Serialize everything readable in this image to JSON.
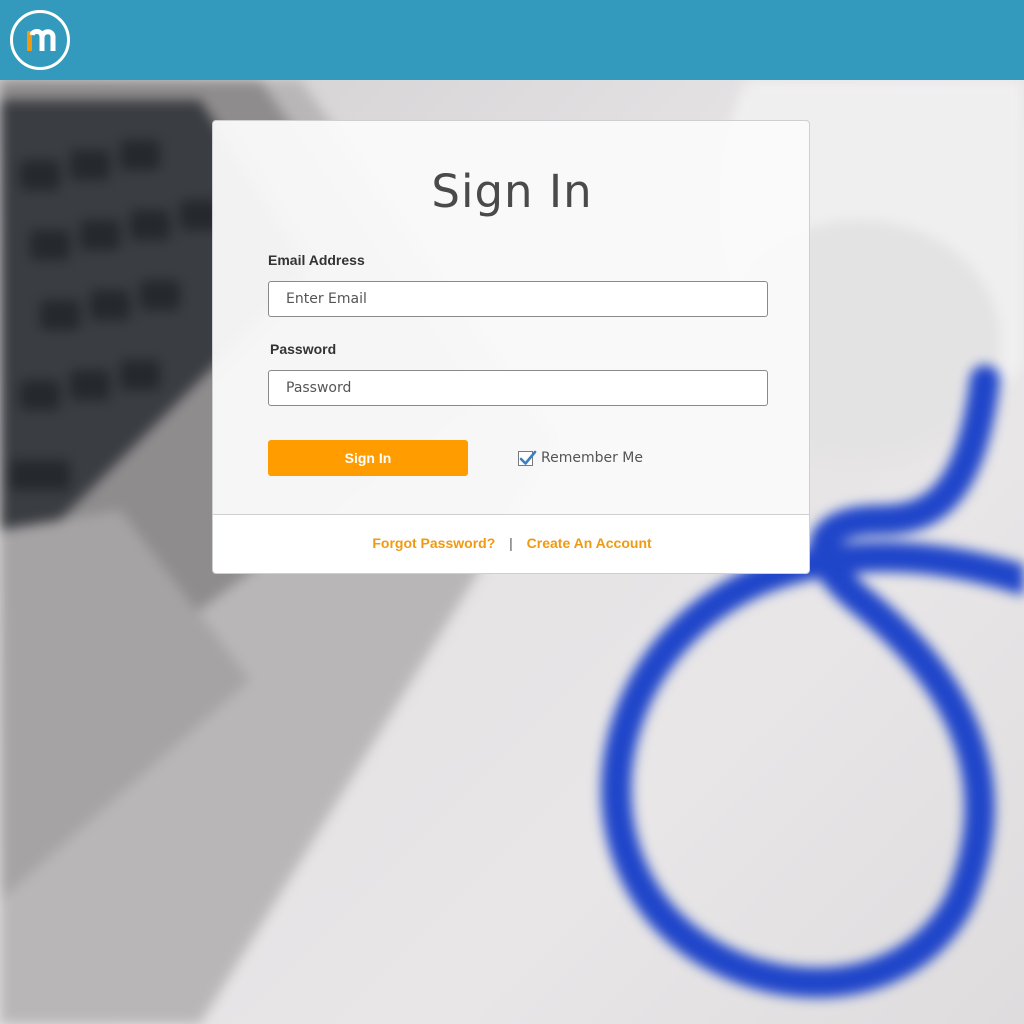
{
  "header": {
    "logo_letter": "m",
    "colors": {
      "bar": "#339abd",
      "logo_accent": "#f09a12"
    }
  },
  "signin": {
    "title": "Sign In",
    "email_label": "Email Address",
    "email_placeholder": "Enter Email",
    "password_label": "Password",
    "password_placeholder": "Password",
    "submit_label": "Sign In",
    "remember_label": "Remember Me",
    "remember_checked": true
  },
  "footer": {
    "forgot_label": "Forgot Password?",
    "separator": "|",
    "create_label": "Create An Account"
  },
  "colors": {
    "primary_button": "#ff9c00",
    "link": "#f09a12",
    "checkbox_check": "#3d7fc1"
  }
}
